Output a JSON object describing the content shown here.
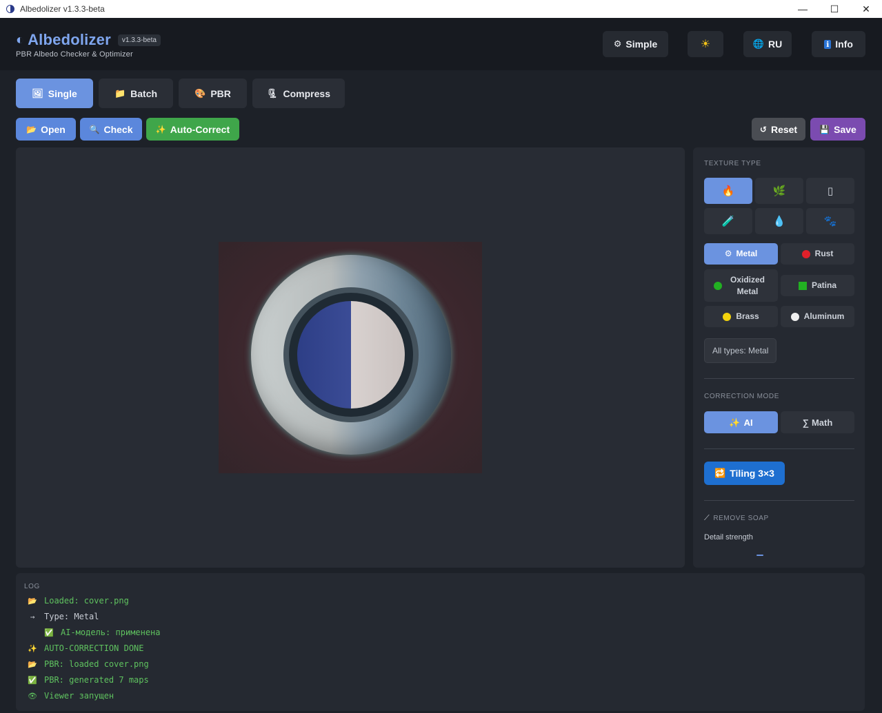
{
  "window": {
    "title": "Albedolizer v1.3.3-beta",
    "controls": {
      "minimize": "—",
      "maximize": "☐",
      "close": "✕"
    }
  },
  "header": {
    "logo_glyph": "◐",
    "app_name": "Albedolizer",
    "version": "v1.3.3-beta",
    "subtitle": "PBR Albedo Checker & Optimizer",
    "buttons": [
      {
        "icon": "⚙",
        "label": "Simple"
      },
      {
        "icon": "☀",
        "label": ""
      },
      {
        "icon": "🌐",
        "label": "RU"
      },
      {
        "icon": "ℹ",
        "label": "Info"
      }
    ]
  },
  "tabs": [
    {
      "icon": "🖼",
      "label": "Single",
      "active": true
    },
    {
      "icon": "📁",
      "label": "Batch",
      "active": false
    },
    {
      "icon": "🎨",
      "label": "PBR",
      "active": false
    },
    {
      "icon": "🗜",
      "label": "Compress",
      "active": false
    }
  ],
  "actions": {
    "open": {
      "icon": "📂",
      "label": "Open"
    },
    "check": {
      "icon": "🔍",
      "label": "Check"
    },
    "auto_correct": {
      "icon": "✨",
      "label": "Auto-Correct"
    },
    "reset": {
      "icon": "↺",
      "label": "Reset"
    },
    "save": {
      "icon": "💾",
      "label": "Save"
    }
  },
  "panel": {
    "texture_type_title": "TEXTURE TYPE",
    "texture_icons": [
      {
        "icon": "🔥",
        "active": true
      },
      {
        "icon": "🌿",
        "active": false
      },
      {
        "icon": "▯",
        "active": false
      },
      {
        "icon": "🧪",
        "active": false
      },
      {
        "icon": "💧",
        "active": false
      },
      {
        "icon": "🐾",
        "active": false
      }
    ],
    "subtypes": [
      {
        "icon": "⚙",
        "label": "Metal",
        "active": true
      },
      {
        "marker": "dot",
        "color": "#e0202a",
        "label": "Rust"
      },
      {
        "marker": "dot",
        "color": "#22b022",
        "label": "Oxidized Metal"
      },
      {
        "marker": "square",
        "color": "#22b022",
        "label": "Patina"
      },
      {
        "marker": "dot",
        "color": "#f2d20c",
        "label": "Brass"
      },
      {
        "marker": "dot",
        "color": "#f0f0f0",
        "label": "Aluminum"
      }
    ],
    "all_types_label": "All types: Metal",
    "correction_mode_title": "CORRECTION MODE",
    "modes": [
      {
        "icon": "✨",
        "label": "AI",
        "active": true
      },
      {
        "icon": "∑",
        "label": "Math",
        "active": false
      }
    ],
    "tiling": {
      "icon": "🔁",
      "label": "Tiling 3×3"
    },
    "remove_soap_title": "REMOVE SOAP",
    "remove_soap_icon": "⟋",
    "detail_strength_label": "Detail strength"
  },
  "log": {
    "title": "LOG",
    "lines": [
      {
        "icon": "📂",
        "text": "Loaded: cover.png",
        "color": "#5fc25f",
        "indent": 0
      },
      {
        "icon": "→",
        "text": "Type: Metal",
        "color": "#c8ccd4",
        "indent": 0
      },
      {
        "icon": "✅",
        "text": "AI-модель: применена",
        "color": "#5fc25f",
        "indent": 1
      },
      {
        "icon": "✨",
        "text": "AUTO-CORRECTION DONE",
        "color": "#5fc25f",
        "indent": 0
      },
      {
        "icon": "📂",
        "text": "PBR: loaded cover.png",
        "color": "#5fc25f",
        "indent": 0
      },
      {
        "icon": "✅",
        "text": "PBR: generated 7 maps",
        "color": "#5fc25f",
        "indent": 0
      },
      {
        "icon": "👁",
        "text": "Viewer запущен",
        "color": "#5fc25f",
        "indent": 0
      }
    ]
  },
  "colors": {
    "accent": "#6b93e0",
    "open": "#5b87dc",
    "check": "#5b87dc",
    "auto_correct": "#3fa64a",
    "reset": "#4a4d53",
    "save": "#7b4bb0",
    "tiling": "#1e6fd0"
  }
}
